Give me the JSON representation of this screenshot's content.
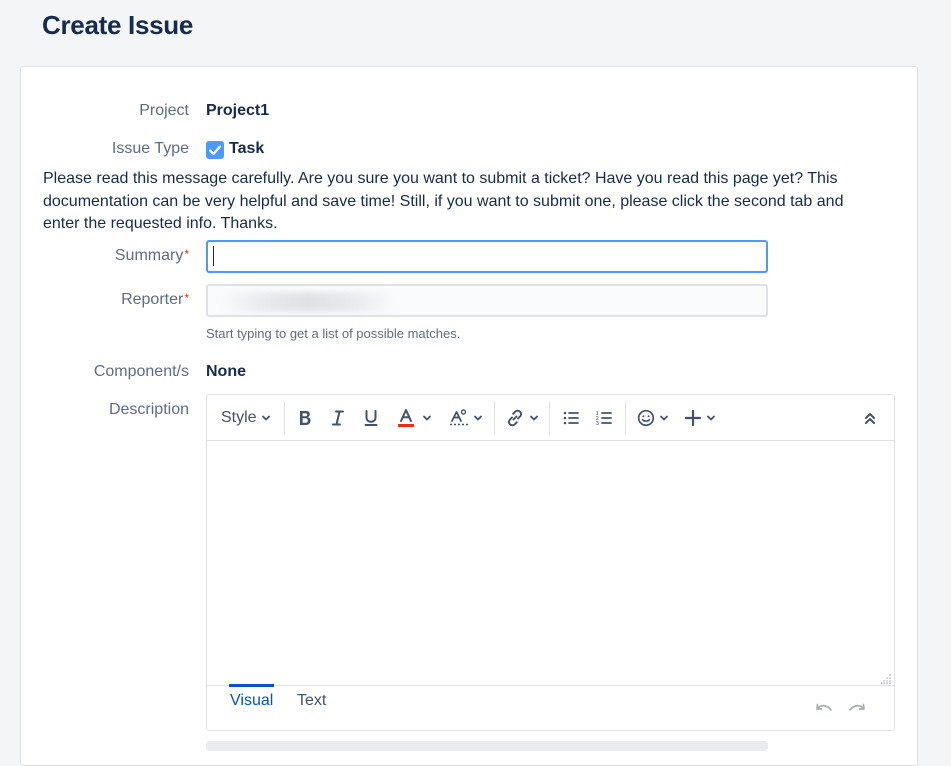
{
  "page": {
    "title": "Create Issue"
  },
  "form": {
    "project": {
      "label": "Project",
      "value": "Project1"
    },
    "issue_type": {
      "label": "Issue Type",
      "value": "Task"
    },
    "notice": "Please read this message carefully. Are you sure you want to submit a ticket? Have you read this page yet? This documentation can be very helpful and save time! Still, if you want to submit one, please click the second tab and enter the requested info. Thanks.",
    "summary": {
      "label": "Summary",
      "required_mark": "*",
      "value": ""
    },
    "reporter": {
      "label": "Reporter",
      "required_mark": "*",
      "hint": "Start typing to get a list of possible matches."
    },
    "components": {
      "label": "Component/s",
      "value": "None"
    },
    "description": {
      "label": "Description"
    }
  },
  "editor": {
    "style_label": "Style",
    "tabs": [
      {
        "label": "Visual",
        "active": true
      },
      {
        "label": "Text",
        "active": false
      }
    ],
    "icons": [
      "bold-icon",
      "italic-icon",
      "underline-icon",
      "text-color-icon",
      "text-format-icon",
      "link-icon",
      "bullet-list-icon",
      "numbered-list-icon",
      "emoji-icon",
      "insert-plus-icon",
      "collapse-toolbar-icon",
      "undo-icon",
      "redo-icon"
    ]
  },
  "colors": {
    "accent": "#4c9aff",
    "link": "#0052cc",
    "required": "#de350b",
    "text_color_underline": "#de350b"
  }
}
